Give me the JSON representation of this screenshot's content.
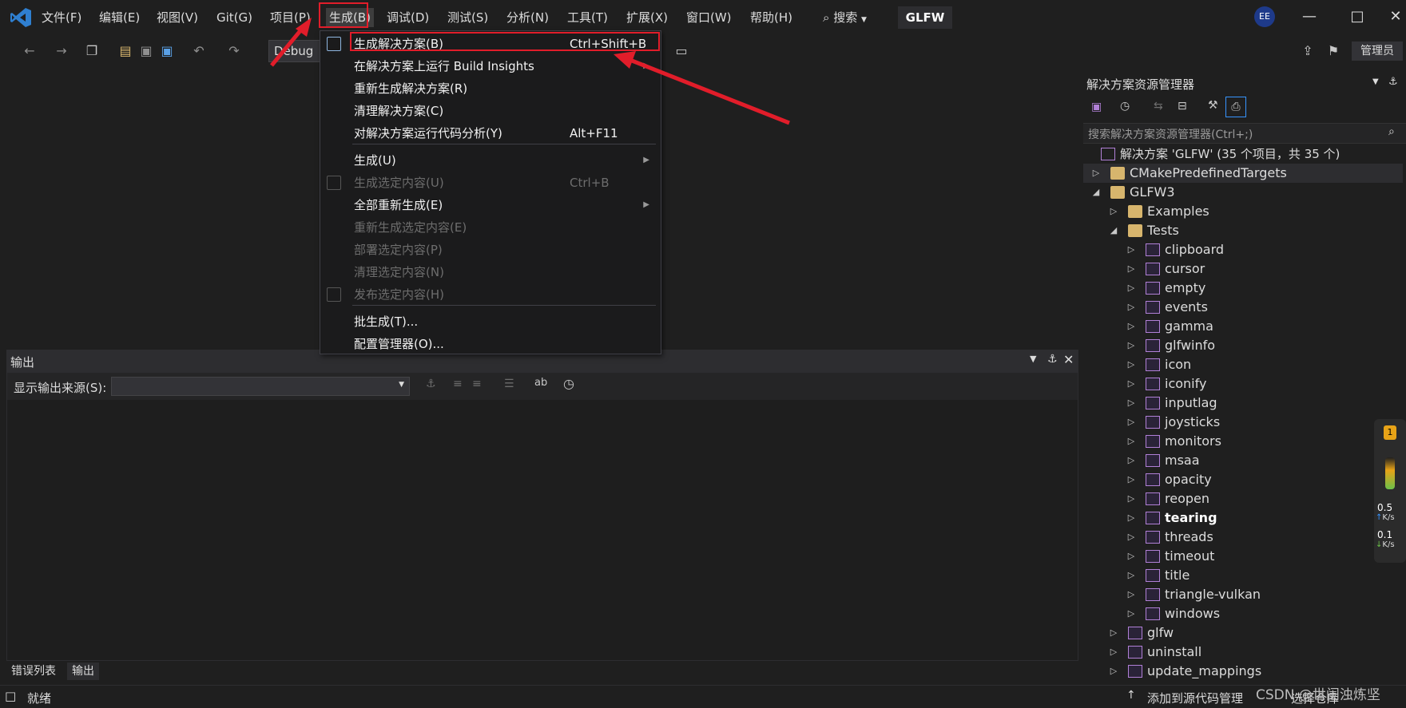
{
  "colors": {
    "background": "#1f1f1f",
    "menu_bg": "#1b1b1c",
    "annotation_red": "#e11d2a",
    "solution_purple": "#b180d7",
    "folder_yellow": "#d7b56d"
  },
  "menubar": {
    "items": [
      "文件(F)",
      "编辑(E)",
      "视图(V)",
      "Git(G)",
      "项目(P)",
      "生成(B)",
      "调试(D)",
      "测试(S)",
      "分析(N)",
      "工具(T)",
      "扩展(X)",
      "窗口(W)",
      "帮助(H)"
    ],
    "search_label": "搜索",
    "solution_badge": "GLFW",
    "avatar": "EE"
  },
  "toolbar": {
    "config": "Debug",
    "admin_label": "管理员"
  },
  "build_menu": {
    "items": [
      {
        "label": "生成解决方案(B)",
        "shortcut": "Ctrl+Shift+B",
        "disabled": false
      },
      {
        "label": "在解决方案上运行 Build Insights",
        "shortcut": "",
        "disabled": false
      },
      {
        "label": "重新生成解决方案(R)",
        "shortcut": "",
        "disabled": false
      },
      {
        "label": "清理解决方案(C)",
        "shortcut": "",
        "disabled": false
      },
      {
        "label": "对解决方案运行代码分析(Y)",
        "shortcut": "Alt+F11",
        "disabled": false
      },
      {
        "label": "生成(U)",
        "shortcut": "",
        "disabled": false
      },
      {
        "label": "生成选定内容(U)",
        "shortcut": "Ctrl+B",
        "disabled": true
      },
      {
        "label": "全部重新生成(E)",
        "shortcut": "",
        "disabled": false
      },
      {
        "label": "重新生成选定内容(E)",
        "shortcut": "",
        "disabled": true
      },
      {
        "label": "部署选定内容(P)",
        "shortcut": "",
        "disabled": true
      },
      {
        "label": "清理选定内容(N)",
        "shortcut": "",
        "disabled": true
      },
      {
        "label": "发布选定内容(H)",
        "shortcut": "",
        "disabled": true
      },
      {
        "label": "批生成(T)...",
        "shortcut": "",
        "disabled": false
      },
      {
        "label": "配置管理器(O)...",
        "shortcut": "",
        "disabled": false
      }
    ]
  },
  "output": {
    "title": "输出",
    "source_label": "显示输出来源(S):",
    "source_value": ""
  },
  "bottom_tabs": [
    "错误列表",
    "输出"
  ],
  "solution_explorer": {
    "title": "解决方案资源管理器",
    "search_placeholder": "搜索解决方案资源管理器(Ctrl+;)",
    "solution_label": "解决方案 'GLFW' (35 个项目，共 35 个)",
    "nodes": [
      {
        "label": "CMakePredefinedTargets",
        "kind": "folder",
        "depth": 0,
        "expanded": false
      },
      {
        "label": "GLFW3",
        "kind": "folder",
        "depth": 0,
        "expanded": true
      },
      {
        "label": "Examples",
        "kind": "folder",
        "depth": 1,
        "expanded": false
      },
      {
        "label": "Tests",
        "kind": "folder",
        "depth": 1,
        "expanded": true
      },
      {
        "label": "clipboard",
        "kind": "project",
        "depth": 2
      },
      {
        "label": "cursor",
        "kind": "project",
        "depth": 2
      },
      {
        "label": "empty",
        "kind": "project",
        "depth": 2
      },
      {
        "label": "events",
        "kind": "project",
        "depth": 2
      },
      {
        "label": "gamma",
        "kind": "project",
        "depth": 2
      },
      {
        "label": "glfwinfo",
        "kind": "project",
        "depth": 2
      },
      {
        "label": "icon",
        "kind": "project",
        "depth": 2
      },
      {
        "label": "iconify",
        "kind": "project",
        "depth": 2
      },
      {
        "label": "inputlag",
        "kind": "project",
        "depth": 2
      },
      {
        "label": "joysticks",
        "kind": "project",
        "depth": 2
      },
      {
        "label": "monitors",
        "kind": "project",
        "depth": 2
      },
      {
        "label": "msaa",
        "kind": "project",
        "depth": 2
      },
      {
        "label": "opacity",
        "kind": "project",
        "depth": 2
      },
      {
        "label": "reopen",
        "kind": "project",
        "depth": 2
      },
      {
        "label": "tearing",
        "kind": "project",
        "depth": 2,
        "bold": true
      },
      {
        "label": "threads",
        "kind": "project",
        "depth": 2
      },
      {
        "label": "timeout",
        "kind": "project",
        "depth": 2
      },
      {
        "label": "title",
        "kind": "project",
        "depth": 2
      },
      {
        "label": "triangle-vulkan",
        "kind": "project",
        "depth": 2
      },
      {
        "label": "windows",
        "kind": "project",
        "depth": 2
      },
      {
        "label": "glfw",
        "kind": "project",
        "depth": 1
      },
      {
        "label": "uninstall",
        "kind": "project",
        "depth": 1
      },
      {
        "label": "update_mappings",
        "kind": "project",
        "depth": 1
      }
    ]
  },
  "net_widget": {
    "badge": "1",
    "up_value": "0.5",
    "up_unit": "K/s",
    "down_value": "0.1",
    "down_unit": "K/s"
  },
  "statusbar": {
    "status": "就绪",
    "add_to_source_control": "添加到源代码管理",
    "select_repo": "选择仓库"
  },
  "watermark": "CSDN @世阑浊炼坚"
}
